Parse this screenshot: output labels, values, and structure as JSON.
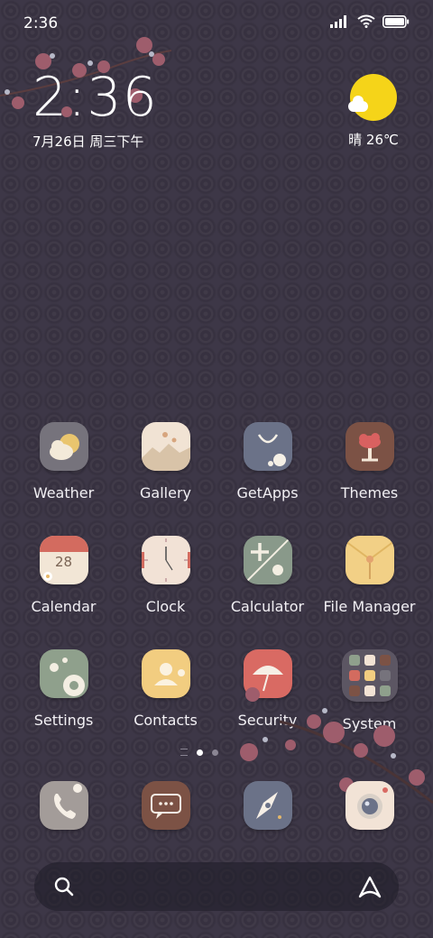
{
  "status_bar": {
    "time": "2:36"
  },
  "clock_widget": {
    "time": "2:36",
    "date": "7月26日 周三下午"
  },
  "weather_widget": {
    "text": "晴 26℃",
    "sun_color": "#f5d419"
  },
  "apps": [
    {
      "label": "Weather",
      "icon": "weather-icon"
    },
    {
      "label": "Gallery",
      "icon": "gallery-icon"
    },
    {
      "label": "GetApps",
      "icon": "getapps-icon"
    },
    {
      "label": "Themes",
      "icon": "themes-icon"
    },
    {
      "label": "Calendar",
      "icon": "calendar-icon",
      "day": "28"
    },
    {
      "label": "Clock",
      "icon": "clock-icon"
    },
    {
      "label": "Calculator",
      "icon": "calculator-icon"
    },
    {
      "label": "File Manager",
      "icon": "file-manager-icon"
    },
    {
      "label": "Settings",
      "icon": "settings-icon"
    },
    {
      "label": "Contacts",
      "icon": "contacts-icon"
    },
    {
      "label": "Security",
      "icon": "security-icon"
    },
    {
      "label": "System",
      "icon": "folder-icon"
    }
  ],
  "dock": [
    {
      "icon": "phone-icon"
    },
    {
      "icon": "messages-icon"
    },
    {
      "icon": "browser-icon"
    },
    {
      "icon": "camera-icon"
    }
  ],
  "pager": {
    "pages": 2,
    "current": 1
  },
  "colors": {
    "background": "#3d3747",
    "accent_pink": "#b06a7a",
    "sun": "#f5d419"
  }
}
